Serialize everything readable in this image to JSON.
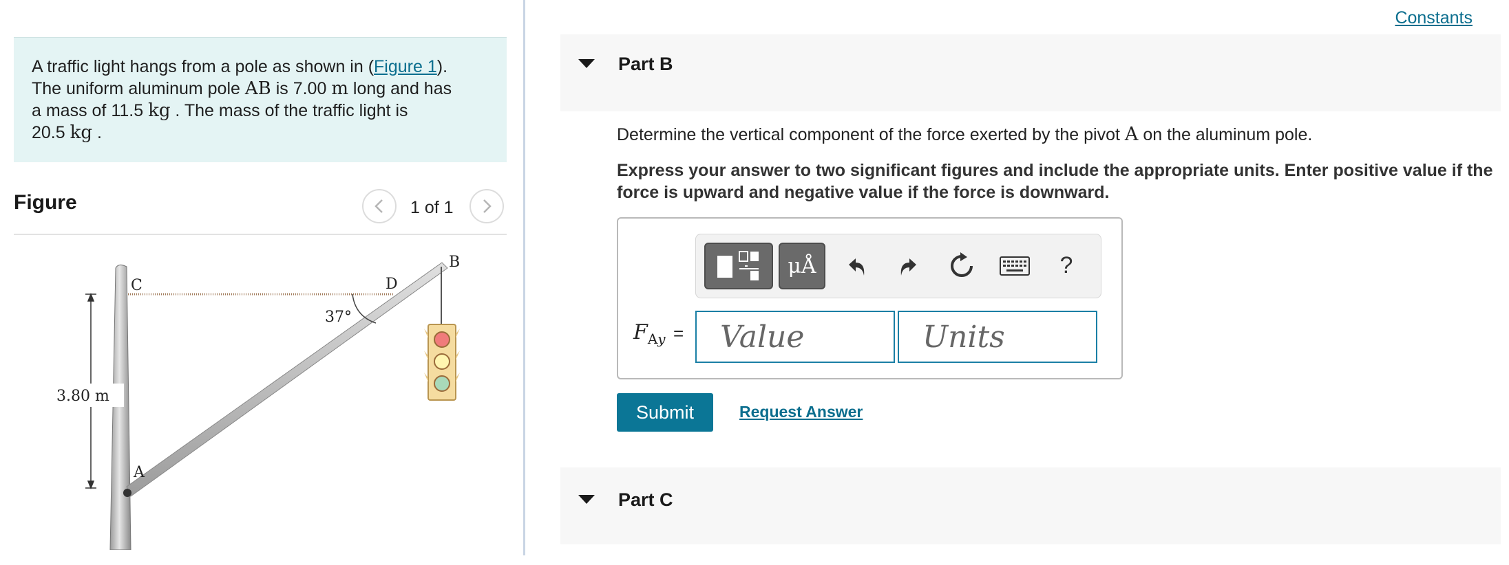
{
  "problem": {
    "text_1": "A traffic light hangs from a pole as shown in (",
    "figure_link": "Figure 1",
    "text_2": ").",
    "text_3": "The uniform aluminum pole ",
    "pole_label": "AB",
    "text_4": " is 7.00 ",
    "unit_m": "m",
    "text_5": " long and has",
    "text_6": "a mass of 11.5 ",
    "unit_kg_1": "kg",
    "text_7": " . The mass of the traffic light is",
    "text_8": "20.5 ",
    "unit_kg_2": "kg",
    "text_9": " ."
  },
  "figure": {
    "title": "Figure",
    "counter": "1 of 1",
    "labels": {
      "c": "C",
      "b": "B",
      "d": "D",
      "a": "A",
      "angle": "37°",
      "height": "3.80 m"
    }
  },
  "header": {
    "constants_link": "Constants"
  },
  "part_b": {
    "label": "Part B",
    "question_prefix": "Determine the vertical component of the force exerted by the pivot ",
    "question_symbol": "A",
    "question_suffix": " on the aluminum pole.",
    "instructions": "Express your answer to two significant figures and include the appropriate units. Enter positive value if the force is upward and negative value if the force is downward.",
    "variable": "F",
    "variable_sub_1": "A",
    "variable_sub_2": "y",
    "equals": "=",
    "value_placeholder": "Value",
    "units_placeholder": "Units",
    "units_button": "μÅ",
    "help_button": "?",
    "submit_label": "Submit",
    "request_answer_label": "Request Answer"
  },
  "part_c": {
    "label": "Part C"
  },
  "icons": {
    "templates": "templates-icon",
    "units": "units-icon",
    "undo": "undo-icon",
    "redo": "redo-icon",
    "reset": "reset-icon",
    "keyboard": "keyboard-icon",
    "help": "help-icon",
    "caret": "caret-down-icon",
    "prev": "chevron-left-icon",
    "next": "chevron-right-icon"
  },
  "colors": {
    "accent": "#0b7696",
    "link": "#0b6e8e",
    "problem_bg": "#e4f4f4",
    "input_border": "#1a7fa5"
  }
}
